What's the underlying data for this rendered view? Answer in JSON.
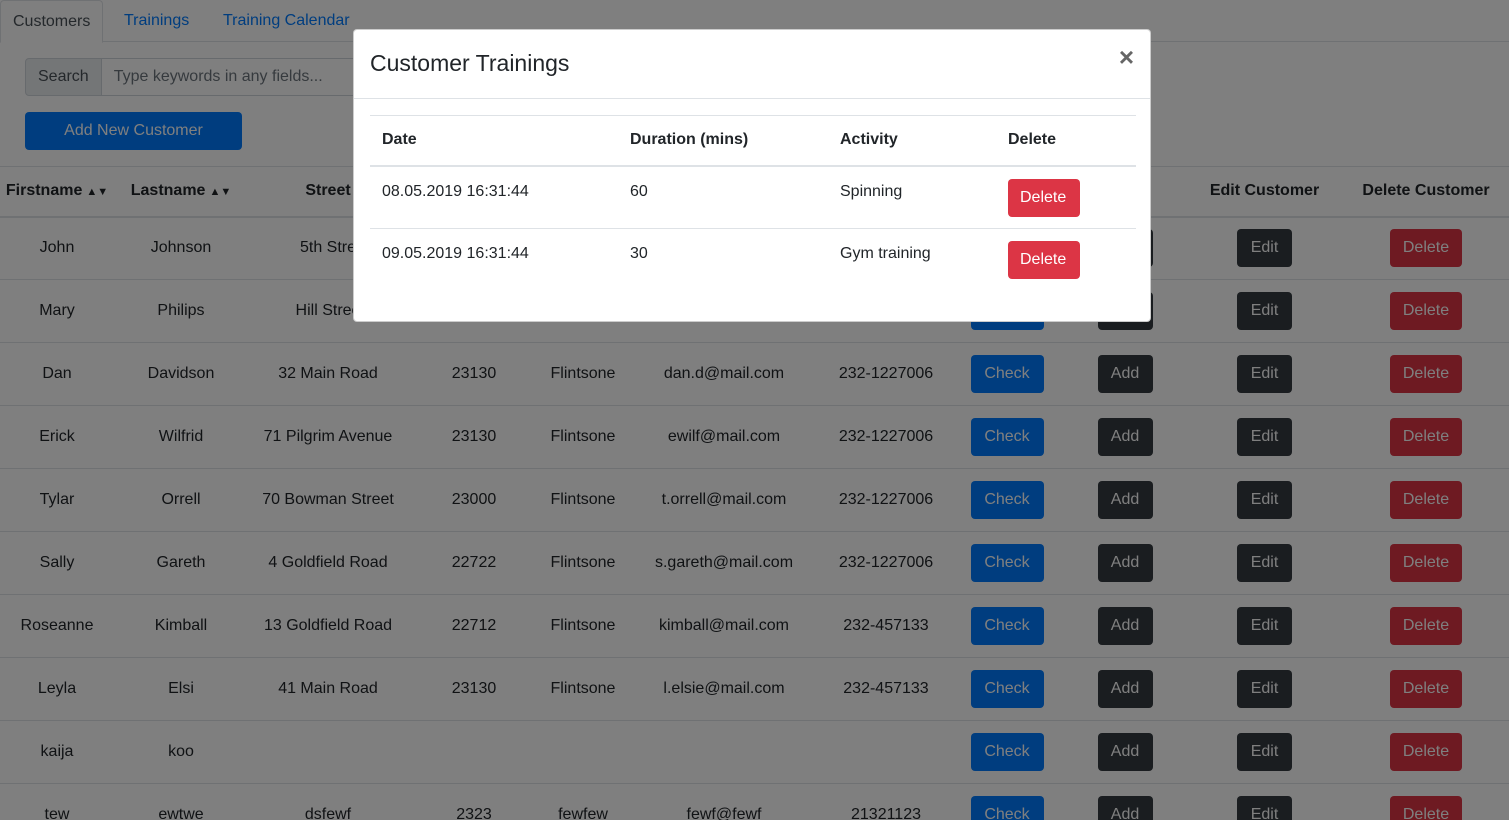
{
  "tabs": [
    {
      "label": "Customers",
      "active": true
    },
    {
      "label": "Trainings",
      "active": false
    },
    {
      "label": "Training Calendar",
      "active": false
    }
  ],
  "search": {
    "label": "Search",
    "placeholder": "Type keywords in any fields..."
  },
  "add_customer_label": "Add New Customer",
  "table": {
    "headers": {
      "firstname": "Firstname",
      "lastname": "Lastname",
      "street": "Street",
      "postcode": "",
      "city": "",
      "email": "",
      "phone": "",
      "trainings": "",
      "add_training": "ing",
      "edit": "Edit Customer",
      "delete": "Delete Customer"
    },
    "rows": [
      {
        "firstname": "John",
        "lastname": "Johnson",
        "street": "5th Stre",
        "postcode": "",
        "city": "",
        "email": "",
        "phone": ""
      },
      {
        "firstname": "Mary",
        "lastname": "Philips",
        "street": "Hill Stree",
        "postcode": "",
        "city": "",
        "email": "",
        "phone": ""
      },
      {
        "firstname": "Dan",
        "lastname": "Davidson",
        "street": "32 Main Road",
        "postcode": "23130",
        "city": "Flintsone",
        "email": "dan.d@mail.com",
        "phone": "232-1227006"
      },
      {
        "firstname": "Erick",
        "lastname": "Wilfrid",
        "street": "71 Pilgrim Avenue",
        "postcode": "23130",
        "city": "Flintsone",
        "email": "ewilf@mail.com",
        "phone": "232-1227006"
      },
      {
        "firstname": "Tylar",
        "lastname": "Orrell",
        "street": "70 Bowman Street",
        "postcode": "23000",
        "city": "Flintsone",
        "email": "t.orrell@mail.com",
        "phone": "232-1227006"
      },
      {
        "firstname": "Sally",
        "lastname": "Gareth",
        "street": "4 Goldfield Road",
        "postcode": "22722",
        "city": "Flintsone",
        "email": "s.gareth@mail.com",
        "phone": "232-1227006"
      },
      {
        "firstname": "Roseanne",
        "lastname": "Kimball",
        "street": "13 Goldfield Road",
        "postcode": "22712",
        "city": "Flintsone",
        "email": "kimball@mail.com",
        "phone": "232-457133"
      },
      {
        "firstname": "Leyla",
        "lastname": "Elsi",
        "street": "41 Main Road",
        "postcode": "23130",
        "city": "Flintsone",
        "email": "l.elsie@mail.com",
        "phone": "232-457133"
      },
      {
        "firstname": "kaija",
        "lastname": "koo",
        "street": "",
        "postcode": "",
        "city": "",
        "email": "",
        "phone": ""
      },
      {
        "firstname": "tew",
        "lastname": "ewtwe",
        "street": "dsfewf",
        "postcode": "2323",
        "city": "fewfew",
        "email": "fewf@fewf",
        "phone": "21321123"
      }
    ],
    "buttons": {
      "check": "Check",
      "add": "Add",
      "edit": "Edit",
      "delete": "Delete"
    }
  },
  "modal": {
    "title": "Customer Trainings",
    "close": "×",
    "headers": {
      "date": "Date",
      "duration": "Duration (mins)",
      "activity": "Activity",
      "delete": "Delete"
    },
    "rows": [
      {
        "date": "08.05.2019 16:31:44",
        "duration": "60",
        "activity": "Spinning",
        "delete": "Delete"
      },
      {
        "date": "09.05.2019 16:31:44",
        "duration": "30",
        "activity": "Gym training",
        "delete": "Delete"
      }
    ]
  },
  "colors": {
    "primary": "#007bff",
    "dark": "#343a40",
    "danger": "#dc3545",
    "backdrop": "rgba(0,0,0,0.5)"
  }
}
